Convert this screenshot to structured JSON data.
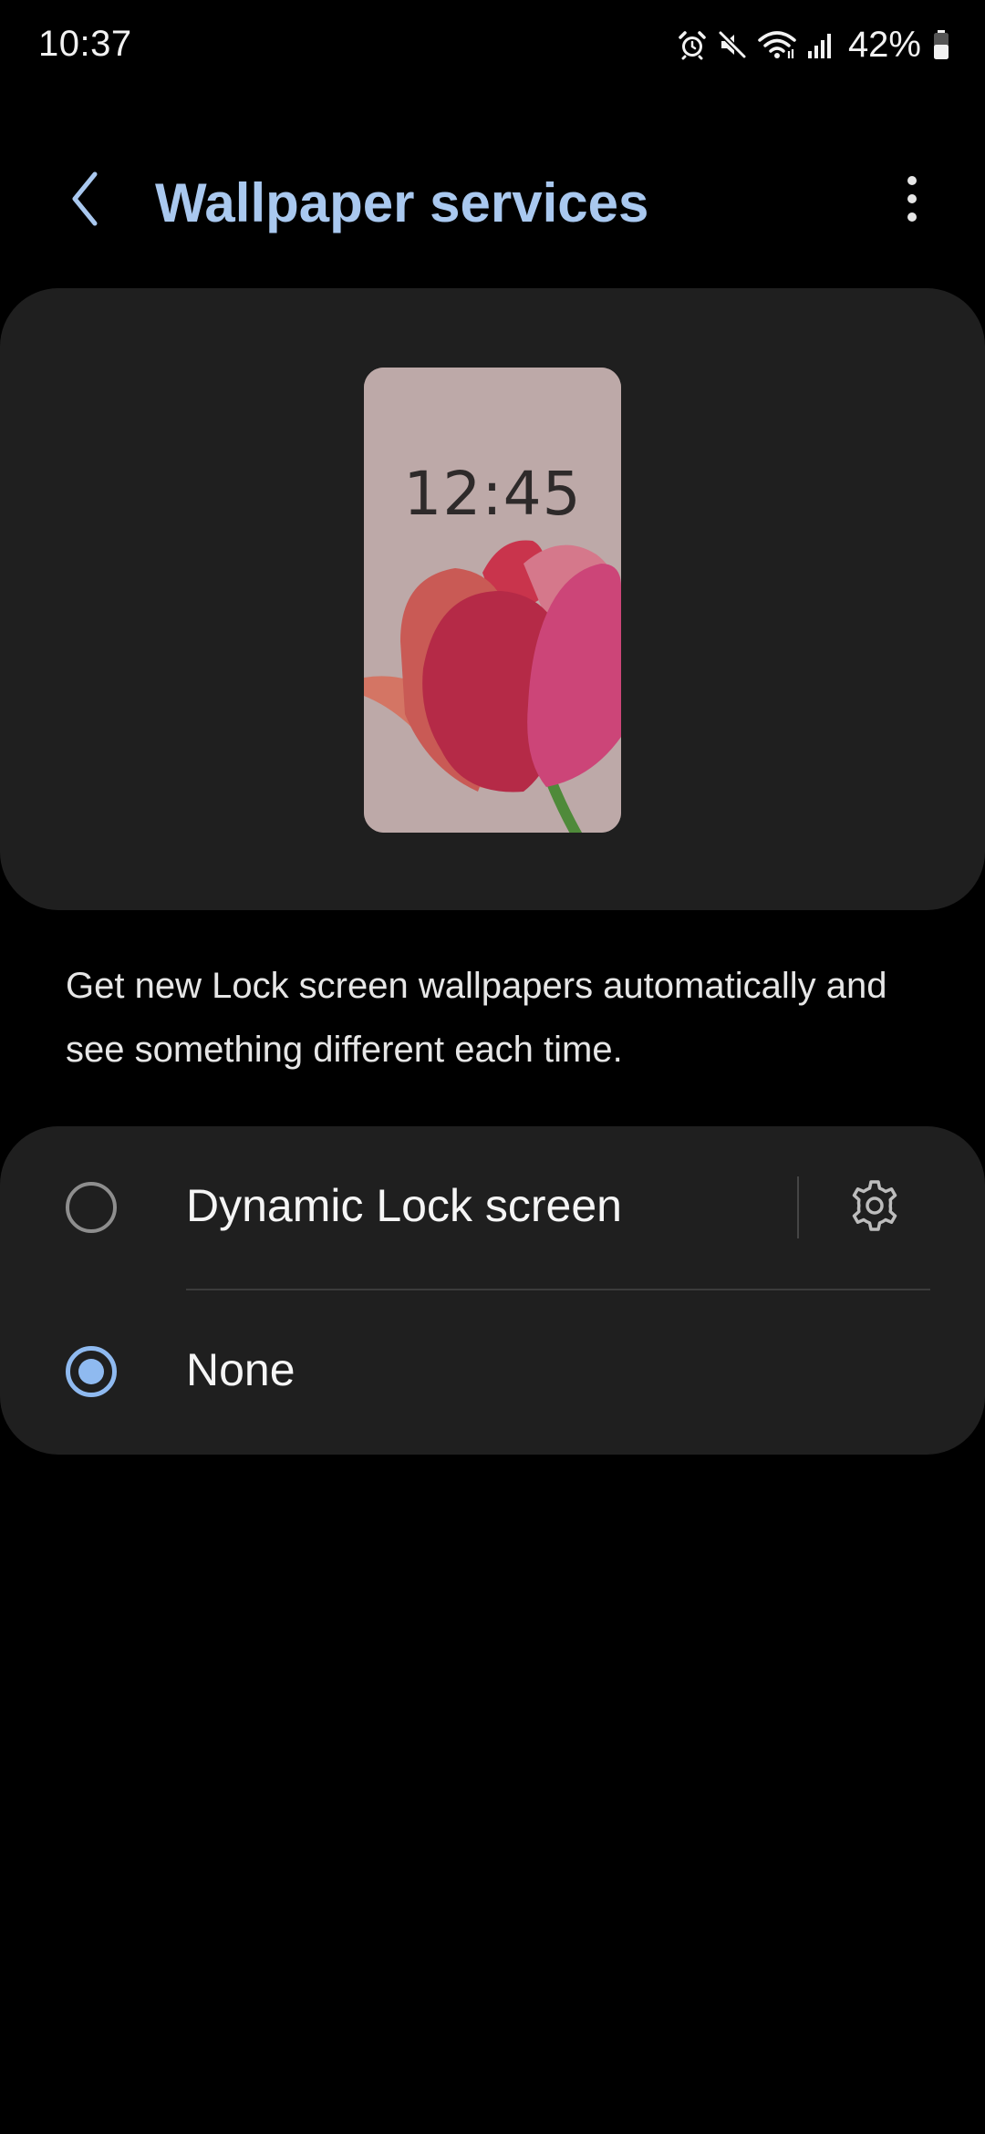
{
  "status_bar": {
    "time": "10:37",
    "battery_percent": "42%",
    "icons": [
      "alarm-icon",
      "mute-icon",
      "wifi-icon",
      "signal-icon",
      "battery-icon"
    ]
  },
  "header": {
    "title": "Wallpaper services",
    "back_icon": "back-arrow-icon",
    "more_icon": "more-options-icon"
  },
  "preview": {
    "clock": "12:45"
  },
  "description": "Get new Lock screen wallpapers automatically and see something different each time.",
  "options": [
    {
      "label": "Dynamic Lock screen",
      "selected": false,
      "has_settings": true,
      "settings_icon": "gear-icon"
    },
    {
      "label": "None",
      "selected": true,
      "has_settings": false
    }
  ],
  "colors": {
    "accent": "#8fbaf0",
    "title": "#a9c8ef",
    "card_background": "#1f1f1f",
    "page_background": "#000000"
  }
}
